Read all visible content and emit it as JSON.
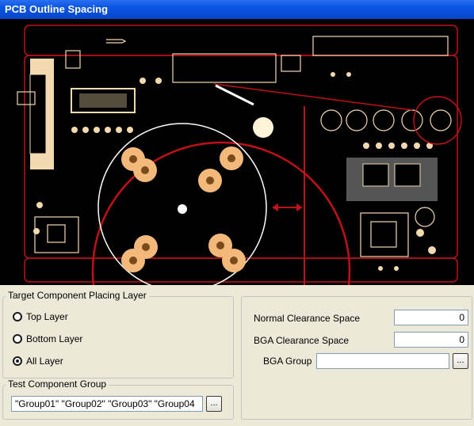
{
  "window": {
    "title": "PCB Outline Spacing"
  },
  "placing_layer": {
    "title": "Target Component Placing Layer",
    "options": [
      {
        "label": "Top Layer",
        "checked": false
      },
      {
        "label": "Bottom Layer",
        "checked": false
      },
      {
        "label": "All Layer",
        "checked": true
      }
    ]
  },
  "test_group": {
    "title": "Test Component Group",
    "value": "\"Group01\" \"Group02\" \"Group03\" \"Group04",
    "browse_label": "..."
  },
  "clearance": {
    "normal_label": "Normal Clearance Space",
    "normal_value": "0",
    "bga_label": "BGA Clearance Space",
    "bga_value": "0",
    "bga_group_label": "BGA Group",
    "bga_group_value": "",
    "browse_label": "..."
  },
  "colors": {
    "title_bar": "#0a54e3",
    "board_background": "#000000",
    "outline": "#c0101a",
    "pad": "#f2b97a",
    "dialog_background": "#ece9d8"
  }
}
